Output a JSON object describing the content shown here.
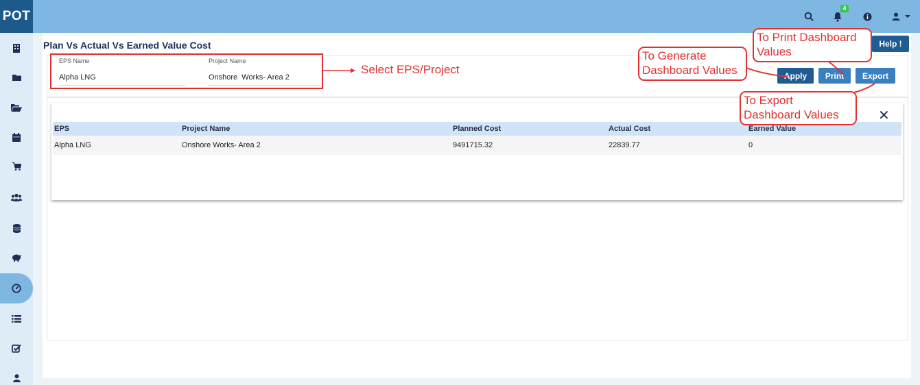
{
  "app": {
    "logo": "POT"
  },
  "topbar": {
    "notification_count": "4",
    "icons": [
      "search-icon",
      "bell-icon",
      "info-icon",
      "user-icon",
      "caret-down-icon"
    ]
  },
  "sidebar": {
    "items": [
      {
        "icon": "building-icon"
      },
      {
        "icon": "folder-icon"
      },
      {
        "icon": "folder-open-icon"
      },
      {
        "icon": "calendar-icon"
      },
      {
        "icon": "cart-icon"
      },
      {
        "icon": "users-icon"
      },
      {
        "icon": "database-icon"
      },
      {
        "icon": "piggy-bank-icon"
      },
      {
        "icon": "dashboard-gauge-icon",
        "active": true
      },
      {
        "icon": "list-icon"
      },
      {
        "icon": "checkbox-icon"
      },
      {
        "icon": "person-icon"
      }
    ]
  },
  "page": {
    "title": "Plan Vs Actual Vs Earned Value Cost",
    "help_label": "Help !"
  },
  "filters": {
    "eps": {
      "label": "EPS Name",
      "value": "Alpha LNG"
    },
    "project": {
      "label": "Project Name",
      "value": "Onshore  Works- Area 2"
    }
  },
  "actions": {
    "apply": "Apply",
    "print": "Print",
    "export": "Export"
  },
  "annotations": {
    "select": "Select EPS/Project",
    "generate": [
      "To Generate",
      "Dashboard Values"
    ],
    "print": [
      "To Print Dashboard",
      "Values"
    ],
    "export": [
      "To Export",
      "Dashboard Values"
    ]
  },
  "table": {
    "columns": [
      "EPS",
      "Project Name",
      "Planned Cost",
      "Actual Cost",
      "Earned Value"
    ],
    "rows": [
      [
        "Alpha LNG",
        "Onshore Works- Area 2",
        "9491715.32",
        "22839.77",
        "0"
      ]
    ]
  },
  "colors": {
    "topbar": "#7fb7e3",
    "logo_bg": "#1d5a8c",
    "primary_button": "#1f5c93",
    "annotation": "#e03131"
  }
}
